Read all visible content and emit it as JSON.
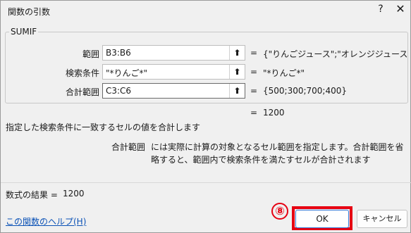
{
  "window": {
    "title": "関数の引数",
    "help_glyph": "?",
    "close_glyph": "✕"
  },
  "function_group": "SUMIF",
  "args": [
    {
      "label": "範囲",
      "value": "B3:B6",
      "result": "{\"りんごジュース\";\"オレンジジュース\";\"..."
    },
    {
      "label": "検索条件",
      "value": "\"*りんご*\"",
      "result": "\"*りんご*\""
    },
    {
      "label": "合計範囲",
      "value": "C3:C6",
      "result": "{500;300;700;400}"
    }
  ],
  "collapse_glyph": "⬆",
  "equals": "=",
  "formula_result_inline": "1200",
  "description": "指定した検索条件に一致するセルの値を合計します",
  "current_arg": {
    "name": "合計範囲",
    "description": "には実際に計算の対象となるセル範囲を指定します。合計範囲を省略すると、範囲内で検索条件を満たすセルが合計されます"
  },
  "result": {
    "label": "数式の結果 =",
    "value": "1200"
  },
  "help_link": "この関数のヘルプ(H)",
  "step_marker": "⑧",
  "buttons": {
    "ok": "OK",
    "cancel": "キャンセル"
  },
  "colors": {
    "accent": "#e60012",
    "link": "#0b52b6"
  }
}
